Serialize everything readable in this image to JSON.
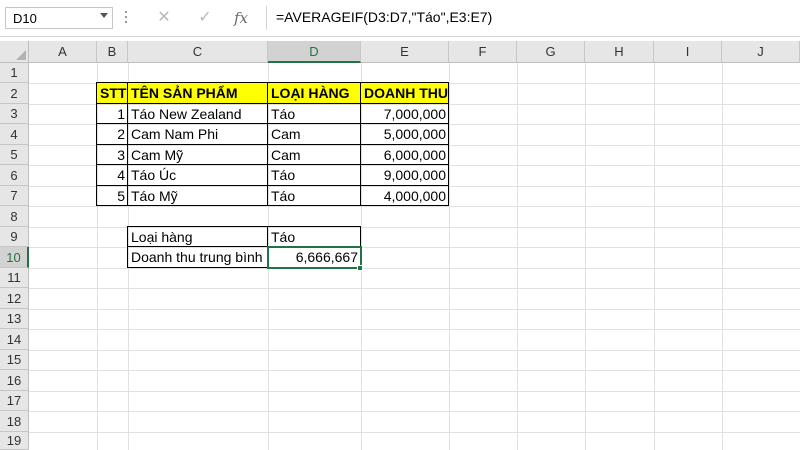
{
  "formula_bar": {
    "name_box": "D10",
    "cancel_icon": "✕",
    "enter_icon": "✓",
    "fx_icon": "fx",
    "formula": "=AVERAGEIF(D3:D7,\"Táo\",E3:E7)"
  },
  "columns": [
    "A",
    "B",
    "C",
    "D",
    "E",
    "F",
    "G",
    "H",
    "I",
    "J"
  ],
  "rows": [
    "1",
    "2",
    "3",
    "4",
    "5",
    "6",
    "7",
    "8",
    "9",
    "10",
    "11",
    "12",
    "13",
    "14",
    "15",
    "16",
    "17",
    "18",
    "19"
  ],
  "selected_cell": "D10",
  "colors": {
    "header_fill": "#ffff00",
    "selection": "#217346"
  },
  "table": {
    "headers": [
      "STT",
      "TÊN SẢN PHẨM",
      "LOẠI HÀNG",
      "DOANH THU"
    ],
    "rows": [
      [
        "1",
        "Táo New Zealand",
        "Táo",
        "7,000,000"
      ],
      [
        "2",
        "Cam Nam Phi",
        "Cam",
        "5,000,000"
      ],
      [
        "3",
        "Cam Mỹ",
        "Cam",
        "6,000,000"
      ],
      [
        "4",
        "Táo Úc",
        "Táo",
        "9,000,000"
      ],
      [
        "5",
        "Táo Mỹ",
        "Táo",
        "4,000,000"
      ]
    ]
  },
  "summary": {
    "category_label": "Loại hàng",
    "category_value": "Táo",
    "average_label": "Doanh thu trung bình",
    "average_value": "6,666,667"
  }
}
